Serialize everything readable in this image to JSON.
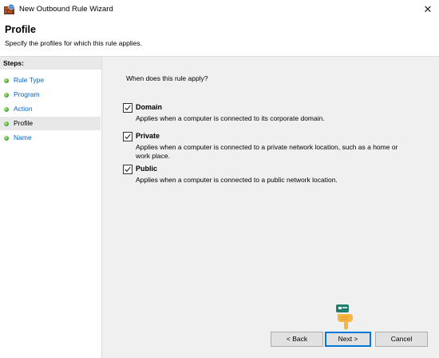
{
  "window": {
    "title": "New Outbound Rule Wizard",
    "close_glyph": "✕"
  },
  "header": {
    "title": "Profile",
    "subtitle": "Specify the profiles for which this rule applies."
  },
  "sidebar": {
    "heading": "Steps:",
    "items": [
      {
        "label": "Rule Type",
        "active": false
      },
      {
        "label": "Program",
        "active": false
      },
      {
        "label": "Action",
        "active": false
      },
      {
        "label": "Profile",
        "active": true
      },
      {
        "label": "Name",
        "active": false
      }
    ]
  },
  "main": {
    "question": "When does this rule apply?",
    "options": [
      {
        "title": "Domain",
        "checked": true,
        "description": "Applies when a computer is connected to its corporate domain."
      },
      {
        "title": "Private",
        "checked": true,
        "description": "Applies when a computer is connected to a private network location, such as a home or work place."
      },
      {
        "title": "Public",
        "checked": true,
        "description": "Applies when a computer is connected to a public network location."
      }
    ]
  },
  "buttons": {
    "back": "< Back",
    "next": "Next >",
    "cancel": "Cancel"
  },
  "icons": {
    "app": "firewall-icon",
    "cursor": "pointing-hand-cursor-icon"
  },
  "colors": {
    "link": "#0066cc",
    "step_dot": "#3fa12b",
    "default_button_border": "#0078d7"
  }
}
